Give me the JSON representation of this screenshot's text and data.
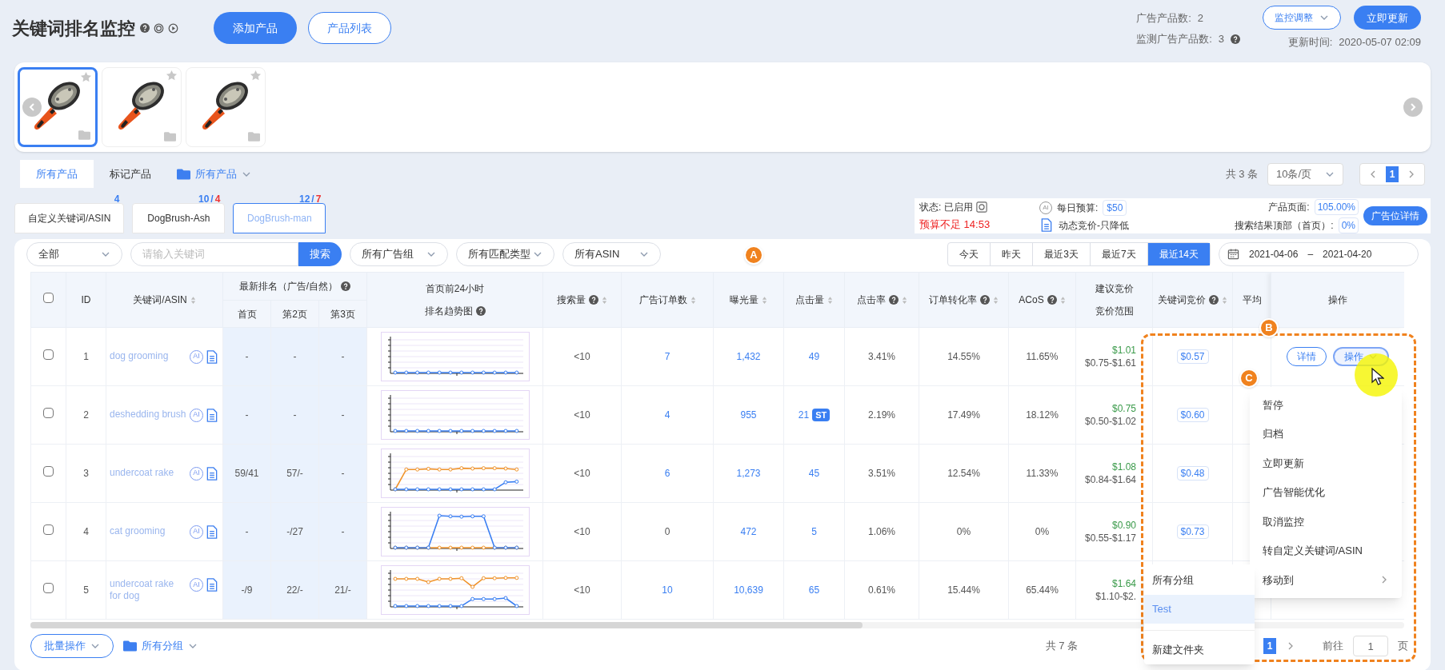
{
  "header": {
    "title": "关键词排名监控",
    "buttons": [
      {
        "label": "添加产品",
        "primary": true
      },
      {
        "label": "产品列表",
        "primary": false
      }
    ],
    "stats": [
      {
        "label": "广告产品数:",
        "value": "2"
      },
      {
        "label": "监测广告产品数:",
        "value": "3",
        "help": true
      }
    ],
    "adjust_button": "监控调整",
    "update_button": "立即更新",
    "update_label": "更新时间:",
    "update_time": "2020-05-07 02:09"
  },
  "products": [
    {
      "selected": true
    },
    {
      "selected": false
    },
    {
      "selected": false
    }
  ],
  "product_tabs": [
    {
      "label": "所有产品",
      "selected": true
    },
    {
      "label": "标记产品",
      "selected": false
    }
  ],
  "folder_filter": "所有产品",
  "top_pagination": {
    "total": "共 3 条",
    "page_size": "10条/页",
    "pages": [
      {
        "label": "1",
        "selected": true
      }
    ]
  },
  "keyword_tabs": [
    {
      "label": "自定义关键词/ASIN",
      "count": "4",
      "selected": false
    },
    {
      "label": "DogBrush-Ash",
      "count": "10",
      "separator": "/",
      "new_count": "4",
      "selected": false
    },
    {
      "label": "DogBrush-man",
      "count": "12",
      "separator": "/",
      "new_count": "7",
      "selected": true
    }
  ],
  "status": {
    "state_label": "状态:",
    "state": "已启用",
    "warning": "预算不足 14:53",
    "ai": "AI",
    "budget_label": "每日预算:",
    "budget": "$50",
    "bidding": "动态竞价-只降低",
    "page_label": "产品页面:",
    "page_value": "105.00%",
    "top_label": "搜索结果顶部（首页）:",
    "top_value": "0%",
    "details_button": "广告位详情"
  },
  "filters": {
    "scope": "全部",
    "keyword_placeholder": "请输入关键词",
    "search_button": "搜索",
    "selects": [
      "所有广告组",
      "所有匹配类型",
      "所有ASIN"
    ],
    "ranges": [
      {
        "label": "今天",
        "selected": false
      },
      {
        "label": "昨天",
        "selected": false
      },
      {
        "label": "最近3天",
        "selected": false
      },
      {
        "label": "最近7天",
        "selected": false
      },
      {
        "label": "最近14天",
        "selected": true
      }
    ],
    "date_from": "2021-04-06",
    "date_sep": "–",
    "date_to": "2021-04-20"
  },
  "table": {
    "header_checked": false,
    "columns": [
      {
        "label": "ID"
      },
      {
        "label": "关键词/ASIN",
        "sort": true
      },
      {
        "label": "最新排名（广告/自然）",
        "help": true,
        "sub": [
          "首页",
          "第2页",
          "第3页"
        ]
      },
      {
        "label": "首页前24小时",
        "label_line2": "排名趋势图",
        "help": true
      },
      {
        "label": "搜索量",
        "help": true,
        "sort": true
      },
      {
        "label": "广告订单数",
        "sort": true
      },
      {
        "label": "曝光量",
        "sort": true
      },
      {
        "label": "点击量",
        "sort": true
      },
      {
        "label": "点击率",
        "help": true,
        "sort": true
      },
      {
        "label": "订单转化率",
        "help": true,
        "sort": true
      },
      {
        "label": "ACoS",
        "help": true,
        "sort": true
      },
      {
        "label": "建议竞价",
        "label_line2": "竞价范围"
      },
      {
        "label": "关键词竞价",
        "help": true,
        "sort": true
      },
      {
        "label": "平均"
      },
      {
        "label": "操作"
      }
    ],
    "rows": [
      {
        "checked": false,
        "id": "1",
        "keyword": "dog grooming",
        "ai": "AI",
        "rank": [
          "-",
          "-",
          "-"
        ],
        "search": "<10",
        "orders": "7",
        "orders_link": true,
        "impressions": "1,432",
        "clicks": "49",
        "ctr": "3.41%",
        "cvr": "14.55%",
        "acos": "11.65%",
        "suggested": "$1.01",
        "range": "$0.75-$1.61",
        "bid": "$0.57",
        "actions": [
          "详情",
          "操作"
        ]
      },
      {
        "checked": false,
        "id": "2",
        "keyword": "deshedding brush",
        "ai": "AI",
        "rank": [
          "-",
          "-",
          "-"
        ],
        "search": "<10",
        "orders": "4",
        "orders_link": true,
        "impressions": "955",
        "clicks": "21",
        "click_tag": "ST",
        "ctr": "2.19%",
        "cvr": "17.49%",
        "acos": "18.12%",
        "suggested": "$0.75",
        "range": "$0.50-$1.02",
        "bid": "$0.60"
      },
      {
        "checked": false,
        "id": "3",
        "keyword": "undercoat rake",
        "ai": "AI",
        "rank": [
          "59/41",
          "57/-",
          "-"
        ],
        "search": "<10",
        "orders": "6",
        "orders_link": true,
        "impressions": "1,273",
        "clicks": "45",
        "ctr": "3.51%",
        "cvr": "12.54%",
        "acos": "11.33%",
        "suggested": "$1.08",
        "range": "$0.84-$1.64",
        "bid": "$0.48"
      },
      {
        "checked": false,
        "id": "4",
        "keyword": "cat grooming",
        "ai": "AI",
        "rank": [
          "-",
          "-/27",
          "-"
        ],
        "search": "<10",
        "orders": "0",
        "orders_link": false,
        "impressions": "472",
        "clicks": "5",
        "ctr": "1.06%",
        "cvr": "0%",
        "acos": "0%",
        "suggested": "$0.90",
        "range": "$0.55-$1.17",
        "bid": "$0.73"
      },
      {
        "checked": false,
        "id": "5",
        "keyword": "undercoat rake for dog",
        "ai": "AI",
        "rank": [
          "-/9",
          "22/-",
          "21/-"
        ],
        "search": "<10",
        "orders": "10",
        "orders_link": true,
        "impressions": "10,639",
        "clicks": "65",
        "ctr": "0.61%",
        "cvr": "15.44%",
        "acos": "65.44%",
        "suggested": "$1.64",
        "range": "$1.10-$2."
      }
    ]
  },
  "action_menu": [
    {
      "label": "暂停"
    },
    {
      "label": "归档"
    },
    {
      "label": "立即更新"
    },
    {
      "label": "广告智能优化"
    },
    {
      "label": "取消监控"
    },
    {
      "label": "转自定义关键词/ASIN"
    },
    {
      "label": "移动到",
      "submenu": true
    }
  ],
  "move_menu": [
    {
      "label": "所有分组",
      "selected": false
    },
    {
      "label": "Test",
      "selected": true
    },
    {
      "label": "新建文件夹",
      "selected": false,
      "divider_before": true
    }
  ],
  "footer": {
    "batch_button": "批量操作",
    "group_filter": "所有分组",
    "total": "共 7 条",
    "page": "1",
    "goto_label": "前往",
    "goto_value": "1",
    "goto_suffix": "页"
  },
  "callouts": [
    "A",
    "B",
    "C"
  ]
}
